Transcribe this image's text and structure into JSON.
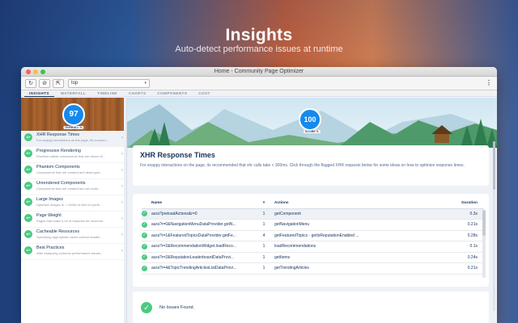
{
  "hero": {
    "title": "Insights",
    "subtitle": "Auto-detect  performance issues at runtime"
  },
  "window": {
    "title": "Home - Community Page Optimizer"
  },
  "toolbar": {
    "url_value": "top",
    "caret": "▾",
    "refresh_glyph": "↻",
    "block_glyph": "⊘",
    "external_glyph": "⇱",
    "menu_glyph": "⋮"
  },
  "tabs": [
    "INSIGHTS",
    "WATERFALL",
    "TIMELINE",
    "CHARTS",
    "COMPONENTS",
    "COST"
  ],
  "overall": {
    "score": "97",
    "label": "OVERALL %"
  },
  "sidebar": {
    "items": [
      {
        "badge": "A+",
        "title": "XHR Response Times",
        "desc": "For snappy interactions on the page, its recomm..."
      },
      {
        "badge": "A+",
        "title": "Progressive Rendering",
        "desc": "Prioritize visible components that are above th..."
      },
      {
        "badge": "A+",
        "title": "Phantom Components",
        "desc": "Components that are created and destroyed..."
      },
      {
        "badge": "A+",
        "title": "Unrendered Components",
        "desc": "Components that are created but not rende..."
      },
      {
        "badge": "A+",
        "title": "Large Images",
        "desc": "Optimize images to < 100kb in size for perfo..."
      },
      {
        "badge": "A+",
        "title": "Page Weight",
        "desc": "Pages that make a lot of requests for resource..."
      },
      {
        "badge": "A+",
        "title": "Cacheable Resources",
        "desc": "Specifying appropriate cache-control header..."
      },
      {
        "badge": "A+",
        "title": "Best Practices",
        "desc": "After analyzing common performance issues..."
      }
    ],
    "chevron": "›"
  },
  "detail": {
    "score": "100",
    "score_label": "SCORE %",
    "title": "XHR Response Times",
    "description": "For snappy interactions on the page, its recommended that xhr calls take < 300ms. Click through the flagged XHR requests below for some ideas on how to optimize response times."
  },
  "table": {
    "headers": {
      "name": "Name",
      "count": "#",
      "actions": "Actions",
      "duration": "Duration"
    },
    "rows": [
      {
        "name": "aura?preloadActions&r=0",
        "count": "1",
        "actions": "getComponent",
        "duration": "0.3s"
      },
      {
        "name": "aura?r=0&NavigationMenuDataProvider.getN...",
        "count": "1",
        "actions": "getNavigationMenu",
        "duration": "0.21s"
      },
      {
        "name": "aura?r=1&FeaturedTopicsDataProvider.getFe...",
        "count": "4",
        "actions": "getFeaturedTopics · getIsReputationEnabled ...",
        "duration": "0.28s"
      },
      {
        "name": "aura?r=2&RecommendationWidget.loadReco...",
        "count": "1",
        "actions": "loadRecommendations",
        "duration": "0.1s"
      },
      {
        "name": "aura?r=2&ReputationLeaderboardDataProvi...",
        "count": "1",
        "actions": "getItems",
        "duration": "0.24s"
      },
      {
        "name": "aura?r=4&TopicTrendingArticlesListDataProvi...",
        "count": "1",
        "actions": "getTrendingArticles",
        "duration": "0.21s"
      }
    ]
  },
  "status": {
    "text": "No Issues Found.",
    "icon_glyph": "✓"
  },
  "colors": {
    "accent": "#1589ee",
    "success": "#4bca81",
    "navy": "#16325c"
  }
}
